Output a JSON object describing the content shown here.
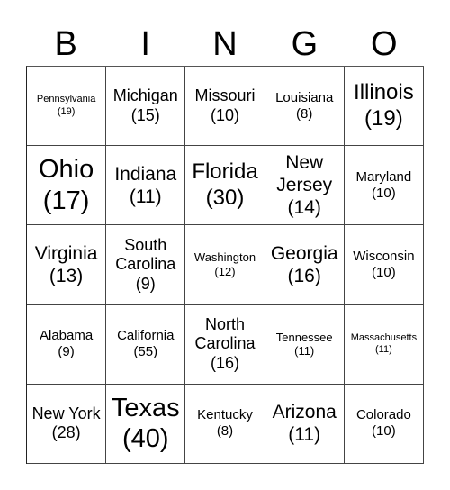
{
  "header": [
    "B",
    "I",
    "N",
    "G",
    "O"
  ],
  "cells": [
    {
      "name": "Pennsylvania",
      "votes": "(19)",
      "size": "xs"
    },
    {
      "name": "Michigan",
      "votes": "(15)",
      "size": "lg"
    },
    {
      "name": "Missouri",
      "votes": "(10)",
      "size": "lg"
    },
    {
      "name": "Louisiana",
      "votes": "(8)",
      "size": "md"
    },
    {
      "name": "Illinois",
      "votes": "(19)",
      "size": "xxl"
    },
    {
      "name": "Ohio",
      "votes": "(17)",
      "size": "huge"
    },
    {
      "name": "Indiana",
      "votes": "(11)",
      "size": "xl"
    },
    {
      "name": "Florida",
      "votes": "(30)",
      "size": "xxl"
    },
    {
      "name": "New Jersey",
      "votes": "(14)",
      "size": "xl"
    },
    {
      "name": "Maryland",
      "votes": "(10)",
      "size": "md"
    },
    {
      "name": "Virginia",
      "votes": "(13)",
      "size": "xl"
    },
    {
      "name": "South Carolina",
      "votes": "(9)",
      "size": "lg"
    },
    {
      "name": "Washington",
      "votes": "(12)",
      "size": "sm"
    },
    {
      "name": "Georgia",
      "votes": "(16)",
      "size": "xl"
    },
    {
      "name": "Wisconsin",
      "votes": "(10)",
      "size": "md"
    },
    {
      "name": "Alabama",
      "votes": "(9)",
      "size": "md"
    },
    {
      "name": "California",
      "votes": "(55)",
      "size": "md"
    },
    {
      "name": "North Carolina",
      "votes": "(16)",
      "size": "lg"
    },
    {
      "name": "Tennessee",
      "votes": "(11)",
      "size": "sm"
    },
    {
      "name": "Massachusetts",
      "votes": "(11)",
      "size": "xs"
    },
    {
      "name": "New York",
      "votes": "(28)",
      "size": "lg"
    },
    {
      "name": "Texas",
      "votes": "(40)",
      "size": "huge"
    },
    {
      "name": "Kentucky",
      "votes": "(8)",
      "size": "md"
    },
    {
      "name": "Arizona",
      "votes": "(11)",
      "size": "xl"
    },
    {
      "name": "Colorado",
      "votes": "(10)",
      "size": "md"
    }
  ]
}
